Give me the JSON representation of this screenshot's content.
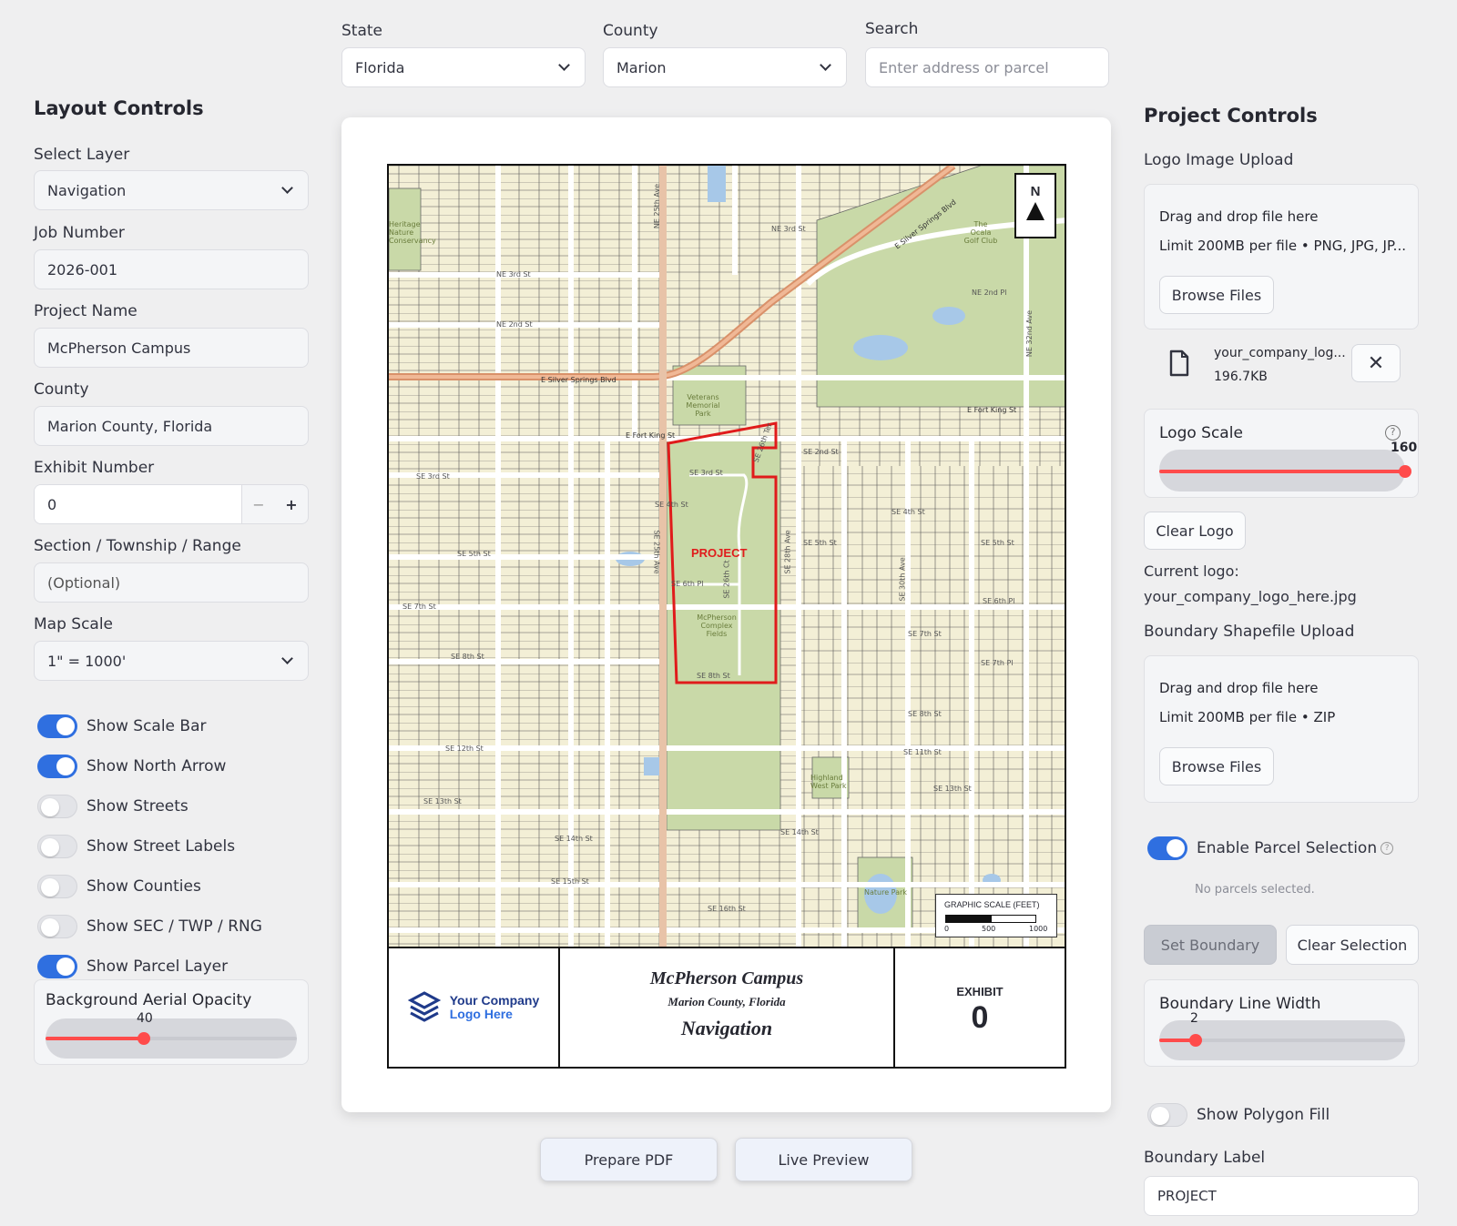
{
  "top": {
    "state_label": "State",
    "state_value": "Florida",
    "county_label": "County",
    "county_value": "Marion",
    "search_label": "Search",
    "search_placeholder": "Enter address or parcel"
  },
  "left": {
    "title": "Layout Controls",
    "select_layer_label": "Select Layer",
    "select_layer_value": "Navigation",
    "job_number_label": "Job Number",
    "job_number_value": "2026-001",
    "project_name_label": "Project Name",
    "project_name_value": "McPherson Campus",
    "county_label": "County",
    "county_value": "Marion County, Florida",
    "exhibit_number_label": "Exhibit Number",
    "exhibit_number_value": "0",
    "stepper_minus": "−",
    "stepper_plus": "+",
    "str_label": "Section / Township / Range",
    "str_placeholder": "(Optional)",
    "map_scale_label": "Map Scale",
    "map_scale_value": "1\" = 1000'",
    "toggles": [
      {
        "label": "Show Scale Bar",
        "on": true
      },
      {
        "label": "Show North Arrow",
        "on": true
      },
      {
        "label": "Show Streets",
        "on": false
      },
      {
        "label": "Show Street Labels",
        "on": false
      },
      {
        "label": "Show Counties",
        "on": false
      },
      {
        "label": "Show SEC / TWP / RNG",
        "on": false
      },
      {
        "label": "Show Parcel Layer",
        "on": true
      }
    ],
    "opacity_label": "Background Aerial Opacity",
    "opacity_value": "40"
  },
  "map": {
    "north": "N",
    "project_label": "PROJECT",
    "scale_title": "GRAPHIC SCALE (FEET)",
    "scale_ticks": [
      "0",
      "500",
      "1000"
    ],
    "streets": {
      "silver_springs": "E Silver Springs Blvd",
      "silver_springs_ne": "E Silver Springs Blvd",
      "fort_king_w": "E Fort King St",
      "fort_king_e": "E Fort King St",
      "ne3rd": "NE 3rd St",
      "ne2nd": "NE 2nd St",
      "ne3rd_e": "NE 3rd St",
      "ne2nd_pl": "NE 2nd Pl",
      "se3rd": "SE 3rd St",
      "se4th": "SE 4th St",
      "se6th": "SE 6th Pl",
      "se8th": "SE 8th St",
      "se2nd": "SE 2nd St",
      "se5th": "SE 5th St",
      "se7th": "SE 7th St",
      "se8th_w": "SE 8th St",
      "se12th": "SE 12th St",
      "se13th": "SE 13th St",
      "se14th": "SE 14th St",
      "se14th_e": "SE 14th St",
      "se15th": "SE 15th St",
      "se16th": "SE 16th St",
      "se3rd_w": "SE 3rd St",
      "se5th_w": "SE 5th St",
      "se4th_e": "SE 4th St",
      "se5th_e": "SE 5th St",
      "se6th_e": "SE 6th Pl",
      "se7th_e": "SE 7th St",
      "se8th_e": "SE 8th St",
      "se11th": "SE 11th St",
      "se13th_e": "SE 13th St",
      "se7th_pl": "SE 7th Pl",
      "se25th_ave": "SE 25th Ave",
      "ne25th_ave": "NE 25th Ave",
      "se26th_ct": "SE 26th Ct",
      "se26th_ter": "SE 26th Ter",
      "se28th": "SE 28th Ave",
      "se30th": "SE 30th Ave",
      "ne32nd": "NE 32nd Ave"
    },
    "places": {
      "golf": "The Ocala Golf Club",
      "veterans": "Veterans Memorial Park",
      "fields": "McPherson Complex Fields",
      "highland": "Highland West Park",
      "nature": "Nature Park",
      "heritage": "Heritage Nature Conservancy"
    }
  },
  "titleblock": {
    "logo_line1": "Your Company",
    "logo_line2": "Logo Here",
    "project": "McPherson Campus",
    "county": "Marion County, Florida",
    "layer": "Navigation",
    "exhibit_label": "EXHIBIT",
    "exhibit_number": "0"
  },
  "buttons": {
    "prepare_pdf": "Prepare PDF",
    "live_preview": "Live Preview"
  },
  "right": {
    "title": "Project Controls",
    "logo_upload_label": "Logo Image Upload",
    "drag_text": "Drag and drop file here",
    "logo_limit": "Limit 200MB per file • PNG, JPG, JP...",
    "browse": "Browse Files",
    "file_name": "your_company_log...",
    "file_size": "196.7KB",
    "logo_scale_label": "Logo Scale",
    "logo_scale_value": "160",
    "clear_logo": "Clear Logo",
    "current_logo_label": "Current logo:",
    "current_logo_value": "your_company_logo_here.jpg",
    "boundary_upload_label": "Boundary Shapefile Upload",
    "boundary_drag": "Drag and drop file here",
    "boundary_limit": "Limit 200MB per file • ZIP",
    "browse2": "Browse Files",
    "parcel_selection_label": "Enable Parcel Selection",
    "no_parcels": "No parcels selected.",
    "set_boundary": "Set Boundary",
    "clear_selection": "Clear Selection",
    "line_width_label": "Boundary Line Width",
    "line_width_value": "2",
    "polygon_fill_label": "Show Polygon Fill",
    "boundary_label_label": "Boundary Label",
    "boundary_label_value": "PROJECT"
  },
  "colors": {
    "accent": "#2f6fe0",
    "slider": "#ff4b4b",
    "map_bg": "#f2efd6",
    "park": "#c9d9a8",
    "water": "#a7c8e8",
    "boundary": "#e01b1b"
  }
}
